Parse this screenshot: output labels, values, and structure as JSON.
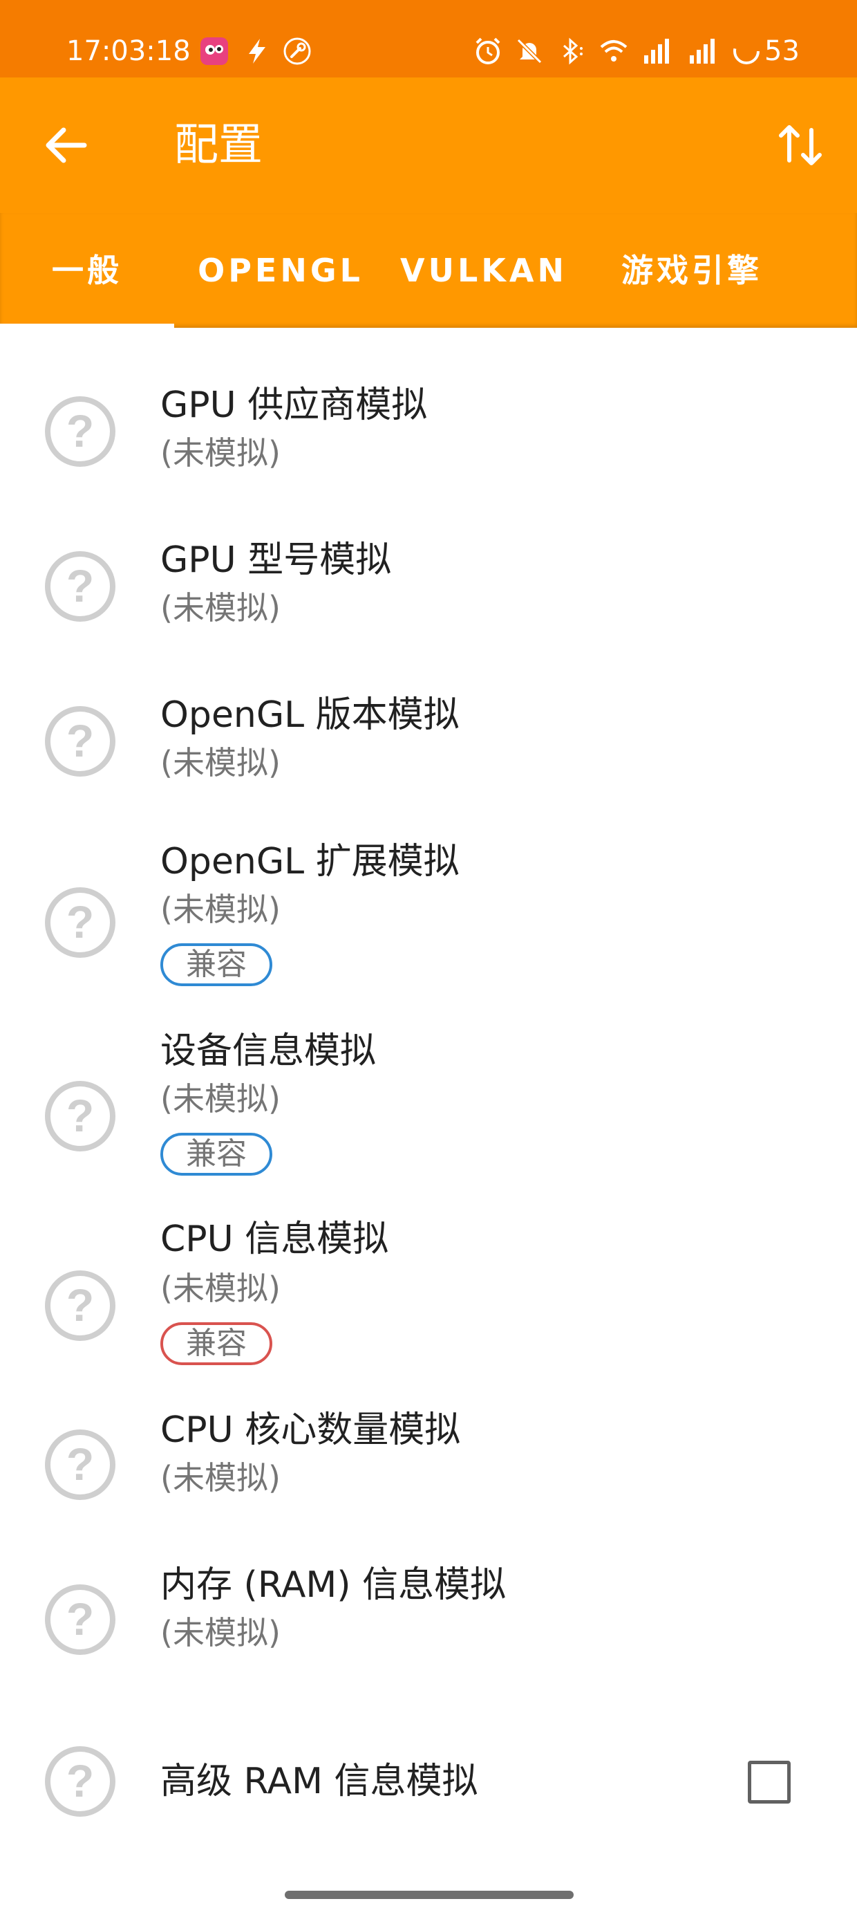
{
  "status_bar": {
    "time": "17:03:18",
    "battery": "53",
    "icons": [
      "app-notification-icon",
      "flash-icon",
      "wrench-icon",
      "alarm-icon",
      "mute-icon",
      "bluetooth-icon",
      "wifi-icon",
      "signal-icon",
      "signal-icon",
      "battery-icon"
    ]
  },
  "app_bar": {
    "title": "配置",
    "back_icon": "arrow-left-icon",
    "sort_icon": "swap-vertical-icon"
  },
  "tabs": [
    {
      "label": "一般",
      "selected": true
    },
    {
      "label": "OPENGL",
      "selected": false
    },
    {
      "label": "VULKAN",
      "selected": false
    },
    {
      "label": "游戏引擎",
      "selected": false
    }
  ],
  "items": [
    {
      "title": "GPU 供应商模拟",
      "subtitle": "(未模拟)"
    },
    {
      "title": "GPU 型号模拟",
      "subtitle": "(未模拟)"
    },
    {
      "title": "OpenGL 版本模拟",
      "subtitle": "(未模拟)"
    },
    {
      "title": "OpenGL 扩展模拟",
      "subtitle": "(未模拟)",
      "badge": "兼容",
      "badge_color": "#2f8ad4"
    },
    {
      "title": "设备信息模拟",
      "subtitle": "(未模拟)",
      "badge": "兼容",
      "badge_color": "#2f8ad4"
    },
    {
      "title": "CPU 信息模拟",
      "subtitle": "(未模拟)",
      "badge": "兼容",
      "badge_color": "#d9534f"
    },
    {
      "title": "CPU 核心数量模拟",
      "subtitle": "(未模拟)"
    },
    {
      "title": "内存 (RAM) 信息模拟",
      "subtitle": "(未模拟)"
    },
    {
      "title": "高级 RAM 信息模拟",
      "checkbox_checked": false
    }
  ],
  "colors": {
    "status_bar": "#f57c00",
    "app_bar": "#ff9800",
    "badge_blue": "#2f8ad4",
    "badge_red": "#d9534f"
  }
}
